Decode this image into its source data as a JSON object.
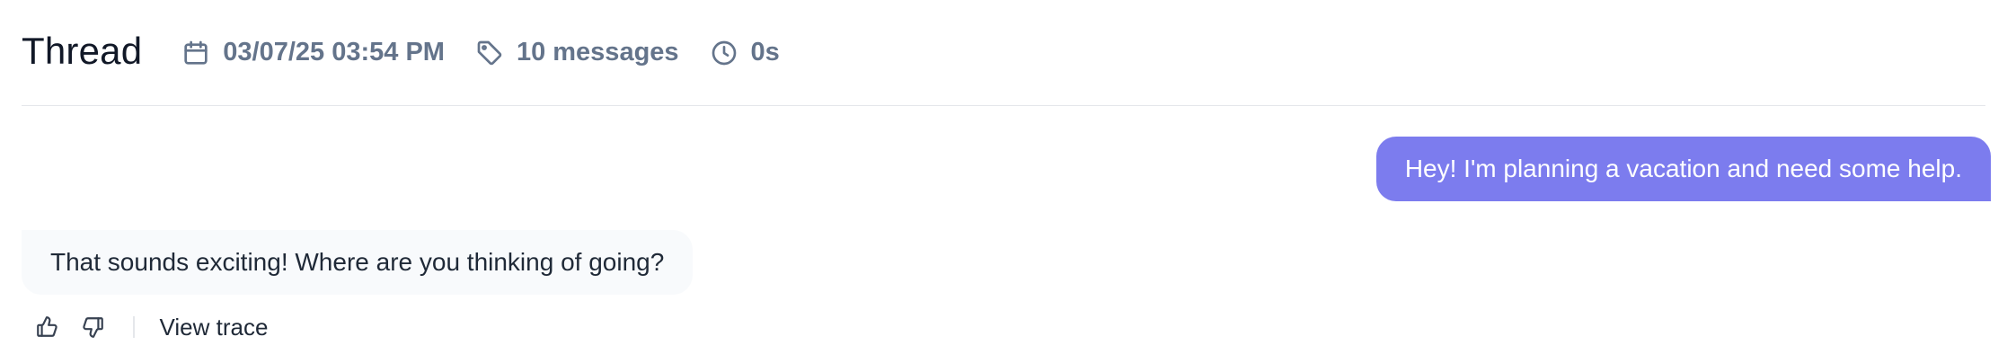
{
  "header": {
    "title": "Thread",
    "date": "03/07/25 03:54 PM",
    "message_count": "10 messages",
    "duration": "0s",
    "icons": {
      "date": "calendar-icon",
      "messages": "tag-icon",
      "duration": "clock-icon"
    }
  },
  "messages": [
    {
      "role": "user",
      "text": "Hey! I'm planning a vacation and need some help."
    },
    {
      "role": "assistant",
      "text": "That sounds exciting! Where are you thinking of going?"
    }
  ],
  "actions": {
    "like_icon": "thumbs-up-icon",
    "dislike_icon": "thumbs-down-icon",
    "view_trace_label": "View trace"
  },
  "colors": {
    "user_bubble": "#7c7cee",
    "assistant_bubble": "#f8fafc",
    "meta_text": "#64748b",
    "divider": "#e5e7eb"
  }
}
